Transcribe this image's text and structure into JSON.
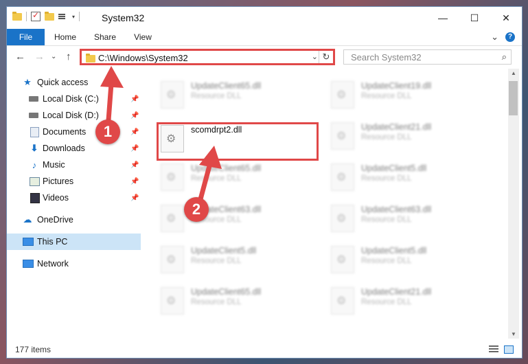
{
  "window": {
    "title": "System32",
    "controls": {
      "minimize": "—",
      "maximize": "☐",
      "close": "✕"
    }
  },
  "ribbon": {
    "tabs": [
      "File",
      "Home",
      "Share",
      "View"
    ],
    "expand": "⌄",
    "help": "?"
  },
  "nav": {
    "back": "←",
    "forward": "→",
    "dropdown": "⌄",
    "up": "↑",
    "address": "C:\\Windows\\System32",
    "address_dropdown": "⌄",
    "refresh": "↻",
    "search_placeholder": "Search System32",
    "search_icon": "⌕"
  },
  "sidebar": {
    "items": [
      {
        "label": "Quick access",
        "icon": "star-icon",
        "pinned": false
      },
      {
        "label": "Local Disk (C:)",
        "icon": "drive-icon",
        "pinned": true
      },
      {
        "label": "Local Disk (D:)",
        "icon": "drive-icon",
        "pinned": true
      },
      {
        "label": "Documents",
        "icon": "documents-icon",
        "pinned": true
      },
      {
        "label": "Downloads",
        "icon": "downloads-icon",
        "pinned": true
      },
      {
        "label": "Music",
        "icon": "music-icon",
        "pinned": true
      },
      {
        "label": "Pictures",
        "icon": "pictures-icon",
        "pinned": true
      },
      {
        "label": "Videos",
        "icon": "videos-icon",
        "pinned": true
      },
      {
        "label": "OneDrive",
        "icon": "cloud-icon",
        "pinned": false
      },
      {
        "label": "This PC",
        "icon": "computer-icon",
        "pinned": false,
        "selected": true
      },
      {
        "label": "Network",
        "icon": "network-icon",
        "pinned": false
      }
    ],
    "pin_glyph": "📌"
  },
  "files": {
    "highlighted": {
      "name": "scomdrpt2.dll",
      "type": ""
    },
    "left_column": [
      {
        "name": "UpdateClient65.dll",
        "type": "Resource DLL"
      },
      {
        "name": "UpdateClient65.dll",
        "type": "Resource DLL"
      },
      {
        "name": "UpdateClient63.dll",
        "type": "Resource DLL"
      },
      {
        "name": "UpdateClient5.dll",
        "type": "Resource DLL"
      },
      {
        "name": "UpdateClient65.dll",
        "type": "Resource DLL"
      }
    ],
    "right_column": [
      {
        "name": "UpdateClient19.dll",
        "type": "Resource DLL"
      },
      {
        "name": "UpdateClient21.dll",
        "type": "Resource DLL"
      },
      {
        "name": "UpdateClient5.dll",
        "type": "Resource DLL"
      },
      {
        "name": "UpdateClient63.dll",
        "type": "Resource DLL"
      },
      {
        "name": "UpdateClient5.dll",
        "type": "Resource DLL"
      },
      {
        "name": "UpdateClient21.dll",
        "type": "Resource DLL"
      }
    ]
  },
  "annotations": {
    "callout_1": "1",
    "callout_2": "2",
    "color": "#e04848"
  },
  "scrollbar": {
    "up": "▲",
    "down": "▼"
  },
  "status": {
    "item_count": "177 items"
  },
  "colors": {
    "accent": "#1a73c8",
    "selection": "#cce4f7",
    "highlight": "#e04848"
  }
}
